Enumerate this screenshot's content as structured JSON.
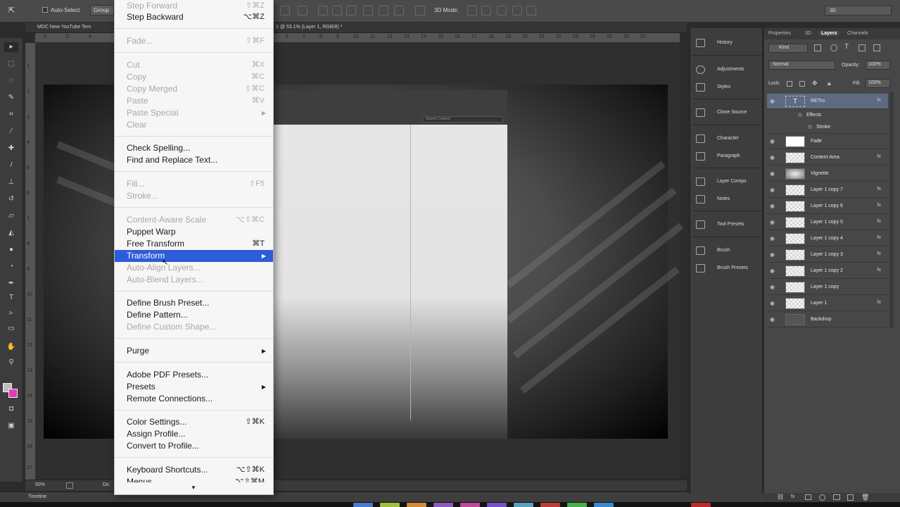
{
  "options_bar": {
    "auto_select": "Auto-Select",
    "group": "Group",
    "mode_3d": "3D Mode:",
    "workspace": "3D"
  },
  "document": {
    "tab_left": "MDC New YouTube Tem",
    "tab_right": "1 @ 53.1% (Layer 1, RGB/8) *",
    "zoom": "50%",
    "doc_label": "Do"
  },
  "rulers": {
    "top_left": [
      "0",
      "2",
      "4"
    ],
    "top": [
      "6",
      "7",
      "8",
      "9",
      "10",
      "11",
      "12",
      "13",
      "14",
      "15",
      "16",
      "17",
      "18",
      "19",
      "20",
      "21",
      "22",
      "23",
      "24",
      "25",
      "26",
      "27"
    ],
    "left": [
      "1",
      "2",
      "3",
      "4",
      "5",
      "6",
      "7",
      "8",
      "9",
      "10",
      "11",
      "12",
      "13",
      "14",
      "15",
      "16",
      "17"
    ]
  },
  "timeline": "Timeline",
  "edit_menu": {
    "items": [
      {
        "label": "Step Forward",
        "shortcut": "⇧⌘Z",
        "disabled": true
      },
      {
        "label": "Step Backward",
        "shortcut": "⌥⌘Z",
        "disabled": false
      },
      {
        "label": "Fade...",
        "shortcut": "⇧⌘F",
        "disabled": true
      },
      {
        "label": "Cut",
        "shortcut": "⌘X",
        "disabled": true
      },
      {
        "label": "Copy",
        "shortcut": "⌘C",
        "disabled": true
      },
      {
        "label": "Copy Merged",
        "shortcut": "⇧⌘C",
        "disabled": true
      },
      {
        "label": "Paste",
        "shortcut": "⌘V",
        "disabled": true
      },
      {
        "label": "Paste Special",
        "shortcut": "",
        "disabled": true,
        "submenu": true
      },
      {
        "label": "Clear",
        "shortcut": "",
        "disabled": true
      },
      {
        "label": "Check Spelling...",
        "shortcut": "",
        "disabled": false
      },
      {
        "label": "Find and Replace Text...",
        "shortcut": "",
        "disabled": false
      },
      {
        "label": "Fill...",
        "shortcut": "⇧F5",
        "disabled": true
      },
      {
        "label": "Stroke...",
        "shortcut": "",
        "disabled": true
      },
      {
        "label": "Content-Aware Scale",
        "shortcut": "⌥⇧⌘C",
        "disabled": true
      },
      {
        "label": "Puppet Warp",
        "shortcut": "",
        "disabled": false
      },
      {
        "label": "Free Transform",
        "shortcut": "⌘T",
        "disabled": false
      },
      {
        "label": "Transform",
        "shortcut": "",
        "disabled": false,
        "submenu": true,
        "highlighted": true
      },
      {
        "label": "Auto-Align Layers...",
        "shortcut": "",
        "disabled": true
      },
      {
        "label": "Auto-Blend Layers...",
        "shortcut": "",
        "disabled": true
      },
      {
        "label": "Define Brush Preset...",
        "shortcut": "",
        "disabled": false
      },
      {
        "label": "Define Pattern...",
        "shortcut": "",
        "disabled": false
      },
      {
        "label": "Define Custom Shape...",
        "shortcut": "",
        "disabled": true
      },
      {
        "label": "Purge",
        "shortcut": "",
        "disabled": false,
        "submenu": true
      },
      {
        "label": "Adobe PDF Presets...",
        "shortcut": "",
        "disabled": false
      },
      {
        "label": "Presets",
        "shortcut": "",
        "disabled": false,
        "submenu": true
      },
      {
        "label": "Remote Connections...",
        "shortcut": "",
        "disabled": false
      },
      {
        "label": "Color Settings...",
        "shortcut": "⇧⌘K",
        "disabled": false
      },
      {
        "label": "Assign Profile...",
        "shortcut": "",
        "disabled": false
      },
      {
        "label": "Convert to Profile...",
        "shortcut": "",
        "disabled": false
      },
      {
        "label": "Keyboard Shortcuts...",
        "shortcut": "⌥⇧⌘K",
        "disabled": false
      },
      {
        "label": "Menus...",
        "shortcut": "⌥⇧⌘M",
        "disabled": false
      }
    ],
    "more_arrow": "▼",
    "highlight_color": "#2c5cd9"
  },
  "mid_panel": {
    "items": [
      {
        "label": "History",
        "icon": "history-icon"
      },
      {
        "label": "Adjustments",
        "icon": "adjustments-icon"
      },
      {
        "label": "Styles",
        "icon": "styles-icon"
      },
      {
        "label": "Clone Source",
        "icon": "clone-source-icon"
      },
      {
        "label": "Character",
        "icon": "character-icon"
      },
      {
        "label": "Paragraph",
        "icon": "paragraph-icon"
      },
      {
        "label": "Layer Comps",
        "icon": "layer-comps-icon"
      },
      {
        "label": "Notes",
        "icon": "notes-icon"
      },
      {
        "label": "Tool Presets",
        "icon": "tool-presets-icon"
      },
      {
        "label": "Brush",
        "icon": "brush-icon"
      },
      {
        "label": "Brush Presets",
        "icon": "brush-presets-icon"
      }
    ]
  },
  "layers_panel": {
    "tabs": [
      "Properties",
      "3D",
      "Layers",
      "Channels"
    ],
    "active_tab": "Layers",
    "kind": "Kind",
    "blend_mode": "Normal",
    "opacity_label": "Opacity:",
    "opacity_value": "100%",
    "lock_label": "Lock:",
    "fill_label": "Fill:",
    "fill_value": "100%",
    "layers": [
      {
        "name": "RETro",
        "type": "text",
        "fx": true,
        "selected": true
      },
      {
        "name": "Effects",
        "type": "effects"
      },
      {
        "name": "Stroke",
        "type": "effect-item"
      },
      {
        "name": "Fade",
        "type": "solid",
        "fx": false
      },
      {
        "name": "Content Area",
        "type": "normal",
        "fx": true
      },
      {
        "name": "Vignette",
        "type": "vignette",
        "fx": false
      },
      {
        "name": "Layer 1 copy 7",
        "type": "normal",
        "fx": true
      },
      {
        "name": "Layer 1 copy 6",
        "type": "normal",
        "fx": true
      },
      {
        "name": "Layer 1 copy 5",
        "type": "normal",
        "fx": true
      },
      {
        "name": "Layer 1 copy 4",
        "type": "normal",
        "fx": true
      },
      {
        "name": "Layer 1 copy 3",
        "type": "normal",
        "fx": true
      },
      {
        "name": "Layer 1 copy 2",
        "type": "normal",
        "fx": true
      },
      {
        "name": "Layer 1 copy",
        "type": "normal",
        "fx": false
      },
      {
        "name": "Layer 1",
        "type": "normal",
        "fx": true
      },
      {
        "name": "Backdrop",
        "type": "backdrop",
        "fx": false
      }
    ],
    "fx_label": "fx"
  },
  "canvas": {
    "search_label": "Search Content"
  }
}
